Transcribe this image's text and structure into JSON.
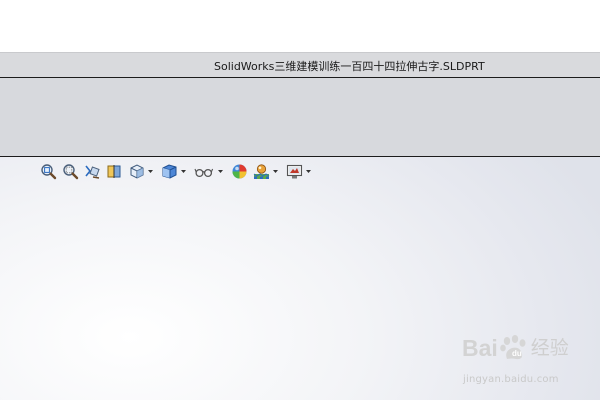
{
  "window": {
    "title": "SolidWorks三维建模训练一百四十四拉伸古字.SLDPRT"
  },
  "toolbar": {
    "buttons": [
      {
        "name": "zoom-to-fit",
        "icon": "magnifier-fit-icon"
      },
      {
        "name": "zoom-to-area",
        "icon": "magnifier-area-icon"
      },
      {
        "name": "previous-view",
        "icon": "previous-view-icon"
      },
      {
        "name": "section-view",
        "icon": "section-view-icon"
      },
      {
        "name": "view-orientation",
        "icon": "view-orientation-icon",
        "dropdown": true
      },
      {
        "name": "display-style",
        "icon": "display-style-cube-icon",
        "dropdown": true
      },
      {
        "name": "hide-show-items",
        "icon": "hide-show-glasses-icon",
        "dropdown": true
      },
      {
        "name": "edit-appearance",
        "icon": "appearance-ball-icon"
      },
      {
        "name": "apply-scene",
        "icon": "scene-icon",
        "dropdown": true
      },
      {
        "name": "view-settings",
        "icon": "view-settings-monitor-icon",
        "dropdown": true
      }
    ]
  },
  "watermark": {
    "brand_latin": "Bai",
    "brand_cn": "经验",
    "url": "jingyan.baidu.com"
  },
  "colors": {
    "title_bar": "#d9dadd",
    "ribbon": "#d7d9dd",
    "viewport_light": "#ffffff",
    "viewport_dark": "#dfe2ea",
    "watermark": "#cfcfcf"
  }
}
